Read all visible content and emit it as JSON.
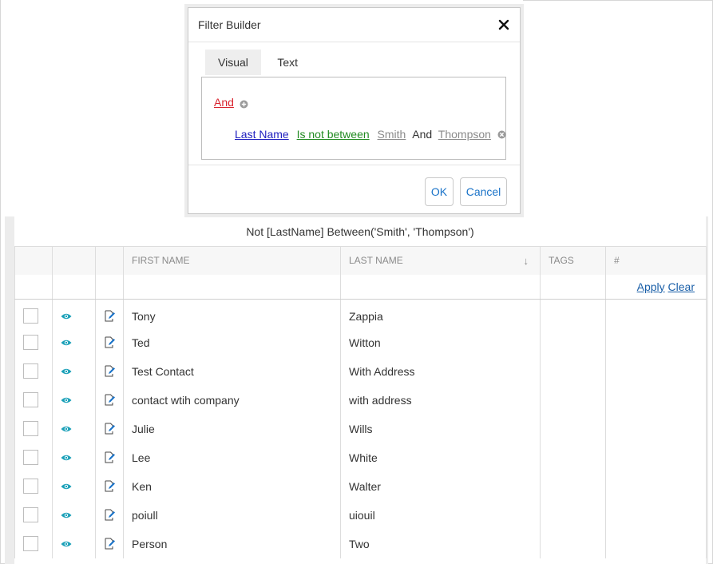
{
  "dialog": {
    "title": "Filter Builder",
    "close_icon": "close-icon",
    "tabs": [
      {
        "label": "Visual",
        "active": true
      },
      {
        "label": "Text",
        "active": false
      }
    ],
    "group_operator": "And",
    "condition": {
      "field": "Last Name",
      "operation": "Is not between",
      "value_start": "Smith",
      "joiner": "And",
      "value_end": "Thompson"
    },
    "ok_label": "OK",
    "cancel_label": "Cancel"
  },
  "grid": {
    "filter_expression": "Not [LastName] Between('Smith', 'Thompson')",
    "columns": {
      "first_name": "FIRST NAME",
      "last_name": "LAST NAME",
      "tags": "TAGS",
      "actions": "#"
    },
    "sort_indicator": "↓",
    "apply_label": "Apply",
    "clear_label": "Clear",
    "rows": [
      {
        "first": "Tony",
        "last": "Zappia"
      },
      {
        "first": "Ted",
        "last": "Witton"
      },
      {
        "first": "Test Contact",
        "last": "With Address"
      },
      {
        "first": "contact wtih company",
        "last": "with address"
      },
      {
        "first": "Julie",
        "last": "Wills"
      },
      {
        "first": "Lee",
        "last": "White"
      },
      {
        "first": "Ken",
        "last": "Walter"
      },
      {
        "first": "poiull",
        "last": "uiouil"
      },
      {
        "first": "Person",
        "last": "Two"
      }
    ]
  },
  "colors": {
    "accent_link": "#1a73c8",
    "eye_icon": "#1aa0b8",
    "group_operator": "#d9232e",
    "field_link": "#1f1fbf",
    "operation_link": "#228b22"
  }
}
